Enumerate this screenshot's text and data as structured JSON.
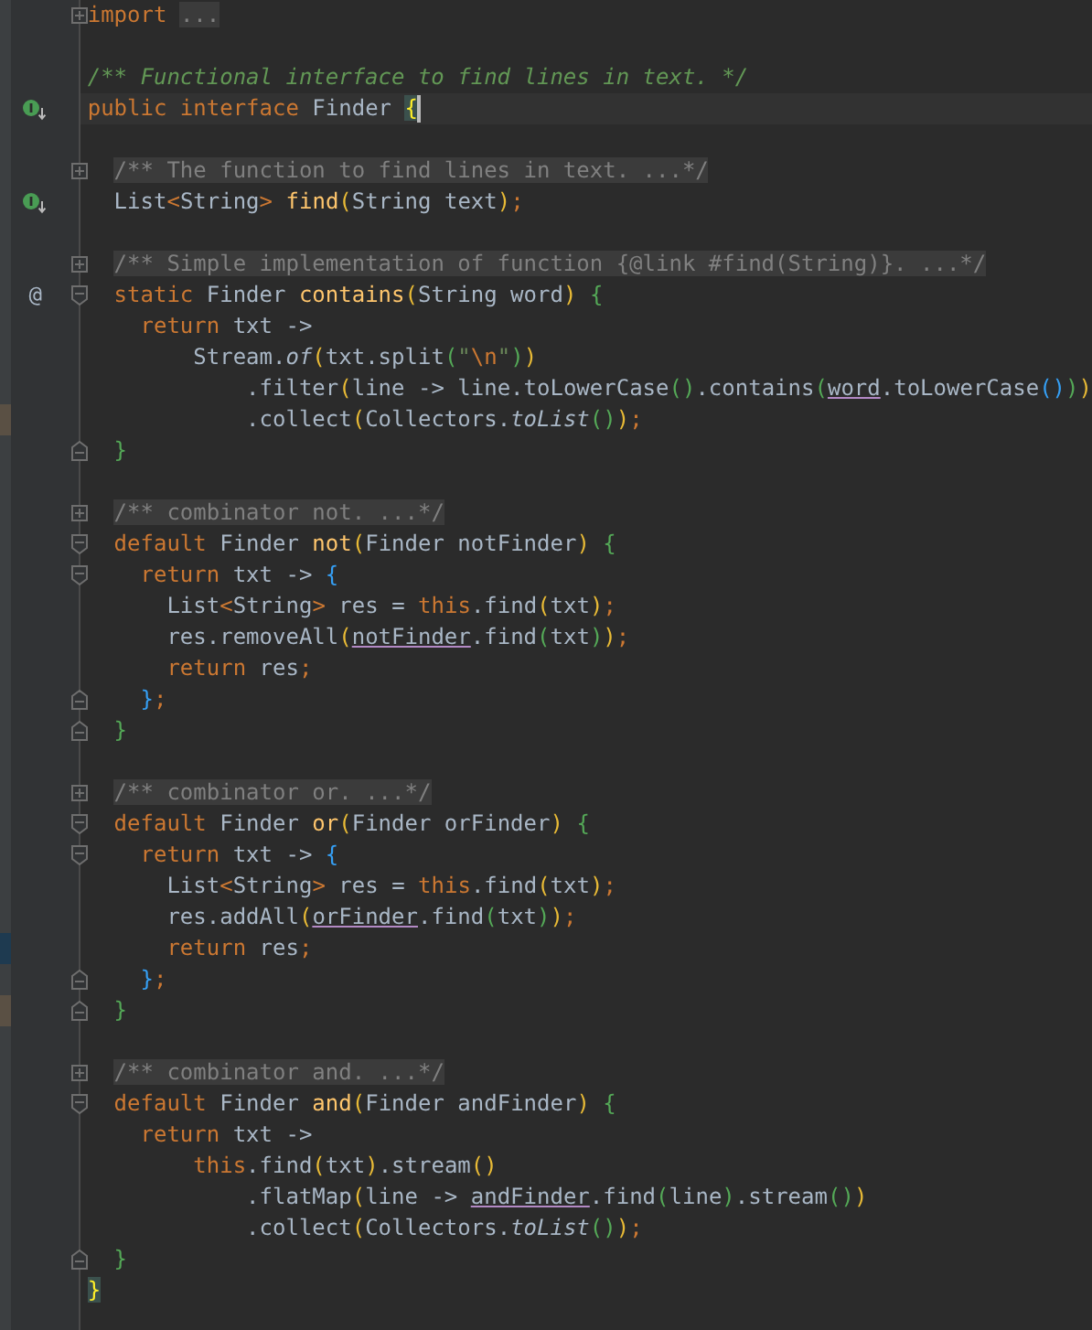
{
  "editor": {
    "lines": [
      {
        "kind": "code",
        "fold_collapsed": true,
        "tokens": [
          {
            "text": "import",
            "kind": "kw"
          },
          {
            "text": " ...",
            "kind": "folded"
          }
        ]
      },
      {
        "kind": "blank"
      },
      {
        "kind": "code",
        "tokens": [
          {
            "text": "/** Functional interface to find lines in text. */",
            "kind": "doc"
          }
        ]
      },
      {
        "kind": "code",
        "implemented": true,
        "current": true,
        "tokens": [
          {
            "text": "public interface ",
            "kind": "kw"
          },
          {
            "text": "Finder ",
            "kind": "plain"
          },
          {
            "text": "{",
            "kind": "match",
            "caret": true
          }
        ]
      },
      {
        "kind": "blank"
      },
      {
        "kind": "code",
        "fold_collapsed": true,
        "tokens": [
          {
            "text": "  /** The function to find lines in text. ...*/",
            "kind": "folded"
          }
        ]
      },
      {
        "kind": "code",
        "implemented": true,
        "tokens": [
          {
            "text": "  List",
            "kind": "plain"
          },
          {
            "text": "<",
            "kind": "kw"
          },
          {
            "text": "String",
            "kind": "plain"
          },
          {
            "text": ">",
            "kind": "kw"
          },
          {
            "text": " find",
            "kind": "decl"
          },
          {
            "text": "(",
            "kind": "p1"
          },
          {
            "text": "String text",
            "kind": "plain"
          },
          {
            "text": ")",
            "kind": "p1"
          },
          {
            "text": ";",
            "kind": "kw"
          }
        ]
      },
      {
        "kind": "blank"
      },
      {
        "kind": "code",
        "fold_collapsed": true,
        "tokens": [
          {
            "text": "  /** Simple implementation of function {@link #find(String)}. ...*/",
            "kind": "folded"
          }
        ]
      },
      {
        "kind": "code",
        "gutter_mark": "@",
        "fold_start": true,
        "tokens": [
          {
            "text": "  static ",
            "kind": "kw"
          },
          {
            "text": "Finder ",
            "kind": "plain"
          },
          {
            "text": "contains",
            "kind": "decl"
          },
          {
            "text": "(",
            "kind": "p1"
          },
          {
            "text": "String word",
            "kind": "plain"
          },
          {
            "text": ")",
            "kind": "p1"
          },
          {
            "text": " {",
            "kind": "p2"
          }
        ]
      },
      {
        "kind": "code",
        "tokens": [
          {
            "text": "    return ",
            "kind": "kw"
          },
          {
            "text": "txt ->",
            "kind": "plain"
          }
        ]
      },
      {
        "kind": "code",
        "tokens": [
          {
            "text": "        Stream.",
            "kind": "plain"
          },
          {
            "text": "of",
            "kind": "italic"
          },
          {
            "text": "(",
            "kind": "p1"
          },
          {
            "text": "txt.split",
            "kind": "plain"
          },
          {
            "text": "(",
            "kind": "p2"
          },
          {
            "text": "\"",
            "kind": "str"
          },
          {
            "text": "\\n",
            "kind": "kw"
          },
          {
            "text": "\"",
            "kind": "str"
          },
          {
            "text": ")",
            "kind": "p2"
          },
          {
            "text": ")",
            "kind": "p1"
          }
        ]
      },
      {
        "kind": "code",
        "tokens": [
          {
            "text": "            .filter",
            "kind": "plain"
          },
          {
            "text": "(",
            "kind": "p1"
          },
          {
            "text": "line -> line.toLowerCase",
            "kind": "plain"
          },
          {
            "text": "()",
            "kind": "p2"
          },
          {
            "text": ".contains",
            "kind": "plain"
          },
          {
            "text": "(",
            "kind": "p2"
          },
          {
            "text": "word",
            "kind": "param"
          },
          {
            "text": ".toLowerCase",
            "kind": "plain"
          },
          {
            "text": "()",
            "kind": "p3"
          },
          {
            "text": ")",
            "kind": "p2"
          },
          {
            "text": ")",
            "kind": "p1"
          }
        ]
      },
      {
        "kind": "code",
        "color": "#5a5044",
        "tokens": [
          {
            "text": "            .collect",
            "kind": "plain"
          },
          {
            "text": "(",
            "kind": "p1"
          },
          {
            "text": "Collectors.",
            "kind": "plain"
          },
          {
            "text": "toList",
            "kind": "italic"
          },
          {
            "text": "()",
            "kind": "p2"
          },
          {
            "text": ")",
            "kind": "p1"
          },
          {
            "text": ";",
            "kind": "kw"
          }
        ]
      },
      {
        "kind": "code",
        "fold_end": true,
        "tokens": [
          {
            "text": "  }",
            "kind": "p2"
          }
        ]
      },
      {
        "kind": "blank"
      },
      {
        "kind": "code",
        "fold_collapsed": true,
        "tokens": [
          {
            "text": "  /** combinator not. ...*/",
            "kind": "folded"
          }
        ]
      },
      {
        "kind": "code",
        "fold_start": true,
        "tokens": [
          {
            "text": "  default ",
            "kind": "kw"
          },
          {
            "text": "Finder ",
            "kind": "plain"
          },
          {
            "text": "not",
            "kind": "decl"
          },
          {
            "text": "(",
            "kind": "p1"
          },
          {
            "text": "Finder notFinder",
            "kind": "plain"
          },
          {
            "text": ")",
            "kind": "p1"
          },
          {
            "text": " {",
            "kind": "p2"
          }
        ]
      },
      {
        "kind": "code",
        "fold_start": true,
        "tokens": [
          {
            "text": "    return ",
            "kind": "kw"
          },
          {
            "text": "txt -> ",
            "kind": "plain"
          },
          {
            "text": "{",
            "kind": "p3"
          }
        ]
      },
      {
        "kind": "code",
        "tokens": [
          {
            "text": "      List",
            "kind": "plain"
          },
          {
            "text": "<",
            "kind": "kw"
          },
          {
            "text": "String",
            "kind": "plain"
          },
          {
            "text": ">",
            "kind": "kw"
          },
          {
            "text": " res = ",
            "kind": "plain"
          },
          {
            "text": "this",
            "kind": "kw"
          },
          {
            "text": ".find",
            "kind": "plain"
          },
          {
            "text": "(",
            "kind": "p1"
          },
          {
            "text": "txt",
            "kind": "plain"
          },
          {
            "text": ")",
            "kind": "p1"
          },
          {
            "text": ";",
            "kind": "kw"
          }
        ]
      },
      {
        "kind": "code",
        "tokens": [
          {
            "text": "      res.removeAll",
            "kind": "plain"
          },
          {
            "text": "(",
            "kind": "p1"
          },
          {
            "text": "notFinder",
            "kind": "param"
          },
          {
            "text": ".find",
            "kind": "plain"
          },
          {
            "text": "(",
            "kind": "p2"
          },
          {
            "text": "txt",
            "kind": "plain"
          },
          {
            "text": ")",
            "kind": "p2"
          },
          {
            "text": ")",
            "kind": "p1"
          },
          {
            "text": ";",
            "kind": "kw"
          }
        ]
      },
      {
        "kind": "code",
        "tokens": [
          {
            "text": "      return ",
            "kind": "kw"
          },
          {
            "text": "res",
            "kind": "plain"
          },
          {
            "text": ";",
            "kind": "kw"
          }
        ]
      },
      {
        "kind": "code",
        "fold_end": true,
        "tokens": [
          {
            "text": "    }",
            "kind": "p3"
          },
          {
            "text": ";",
            "kind": "kw"
          }
        ]
      },
      {
        "kind": "code",
        "fold_end": true,
        "tokens": [
          {
            "text": "  }",
            "kind": "p2"
          }
        ]
      },
      {
        "kind": "blank"
      },
      {
        "kind": "code",
        "fold_collapsed": true,
        "tokens": [
          {
            "text": "  /** combinator or. ...*/",
            "kind": "folded"
          }
        ]
      },
      {
        "kind": "code",
        "fold_start": true,
        "tokens": [
          {
            "text": "  default ",
            "kind": "kw"
          },
          {
            "text": "Finder ",
            "kind": "plain"
          },
          {
            "text": "or",
            "kind": "decl"
          },
          {
            "text": "(",
            "kind": "p1"
          },
          {
            "text": "Finder orFinder",
            "kind": "plain"
          },
          {
            "text": ")",
            "kind": "p1"
          },
          {
            "text": " {",
            "kind": "p2"
          }
        ]
      },
      {
        "kind": "code",
        "fold_start": true,
        "tokens": [
          {
            "text": "    return ",
            "kind": "kw"
          },
          {
            "text": "txt -> ",
            "kind": "plain"
          },
          {
            "text": "{",
            "kind": "p3"
          }
        ]
      },
      {
        "kind": "code",
        "tokens": [
          {
            "text": "      List",
            "kind": "plain"
          },
          {
            "text": "<",
            "kind": "kw"
          },
          {
            "text": "String",
            "kind": "plain"
          },
          {
            "text": ">",
            "kind": "kw"
          },
          {
            "text": " res = ",
            "kind": "plain"
          },
          {
            "text": "this",
            "kind": "kw"
          },
          {
            "text": ".find",
            "kind": "plain"
          },
          {
            "text": "(",
            "kind": "p1"
          },
          {
            "text": "txt",
            "kind": "plain"
          },
          {
            "text": ")",
            "kind": "p1"
          },
          {
            "text": ";",
            "kind": "kw"
          }
        ]
      },
      {
        "kind": "code",
        "tokens": [
          {
            "text": "      res.addAll",
            "kind": "plain"
          },
          {
            "text": "(",
            "kind": "p1"
          },
          {
            "text": "orFinder",
            "kind": "param"
          },
          {
            "text": ".find",
            "kind": "plain"
          },
          {
            "text": "(",
            "kind": "p2"
          },
          {
            "text": "txt",
            "kind": "plain"
          },
          {
            "text": ")",
            "kind": "p2"
          },
          {
            "text": ")",
            "kind": "p1"
          },
          {
            "text": ";",
            "kind": "kw"
          }
        ]
      },
      {
        "kind": "code",
        "color": "#1e3a50",
        "tokens": [
          {
            "text": "      return ",
            "kind": "kw"
          },
          {
            "text": "res",
            "kind": "plain"
          },
          {
            "text": ";",
            "kind": "kw"
          }
        ]
      },
      {
        "kind": "code",
        "fold_end": true,
        "tokens": [
          {
            "text": "    }",
            "kind": "p3"
          },
          {
            "text": ";",
            "kind": "kw"
          }
        ]
      },
      {
        "kind": "code",
        "fold_end": true,
        "color": "#5a5044",
        "tokens": [
          {
            "text": "  }",
            "kind": "p2"
          }
        ]
      },
      {
        "kind": "blank"
      },
      {
        "kind": "code",
        "fold_collapsed": true,
        "tokens": [
          {
            "text": "  /** combinator and. ...*/",
            "kind": "folded"
          }
        ]
      },
      {
        "kind": "code",
        "fold_start": true,
        "tokens": [
          {
            "text": "  default ",
            "kind": "kw"
          },
          {
            "text": "Finder ",
            "kind": "plain"
          },
          {
            "text": "and",
            "kind": "decl"
          },
          {
            "text": "(",
            "kind": "p1"
          },
          {
            "text": "Finder andFinder",
            "kind": "plain"
          },
          {
            "text": ")",
            "kind": "p1"
          },
          {
            "text": " {",
            "kind": "p2"
          }
        ]
      },
      {
        "kind": "code",
        "tokens": [
          {
            "text": "    return ",
            "kind": "kw"
          },
          {
            "text": "txt ->",
            "kind": "plain"
          }
        ]
      },
      {
        "kind": "code",
        "tokens": [
          {
            "text": "        this",
            "kind": "kw"
          },
          {
            "text": ".find",
            "kind": "plain"
          },
          {
            "text": "(",
            "kind": "p1"
          },
          {
            "text": "txt",
            "kind": "plain"
          },
          {
            "text": ")",
            "kind": "p1"
          },
          {
            "text": ".stream",
            "kind": "plain"
          },
          {
            "text": "()",
            "kind": "p1"
          }
        ]
      },
      {
        "kind": "code",
        "tokens": [
          {
            "text": "            .flatMap",
            "kind": "plain"
          },
          {
            "text": "(",
            "kind": "p1"
          },
          {
            "text": "line -> ",
            "kind": "plain"
          },
          {
            "text": "andFinder",
            "kind": "param"
          },
          {
            "text": ".find",
            "kind": "plain"
          },
          {
            "text": "(",
            "kind": "p2"
          },
          {
            "text": "line",
            "kind": "plain"
          },
          {
            "text": ")",
            "kind": "p2"
          },
          {
            "text": ".stream",
            "kind": "plain"
          },
          {
            "text": "()",
            "kind": "p2"
          },
          {
            "text": ")",
            "kind": "p1"
          }
        ]
      },
      {
        "kind": "code",
        "tokens": [
          {
            "text": "            .collect",
            "kind": "plain"
          },
          {
            "text": "(",
            "kind": "p1"
          },
          {
            "text": "Collectors.",
            "kind": "plain"
          },
          {
            "text": "toList",
            "kind": "italic"
          },
          {
            "text": "()",
            "kind": "p2"
          },
          {
            "text": ")",
            "kind": "p1"
          },
          {
            "text": ";",
            "kind": "kw"
          }
        ]
      },
      {
        "kind": "code",
        "fold_end": true,
        "tokens": [
          {
            "text": "  }",
            "kind": "p2"
          }
        ]
      },
      {
        "kind": "code",
        "tokens": [
          {
            "text": "}",
            "kind": "match"
          }
        ]
      }
    ]
  }
}
